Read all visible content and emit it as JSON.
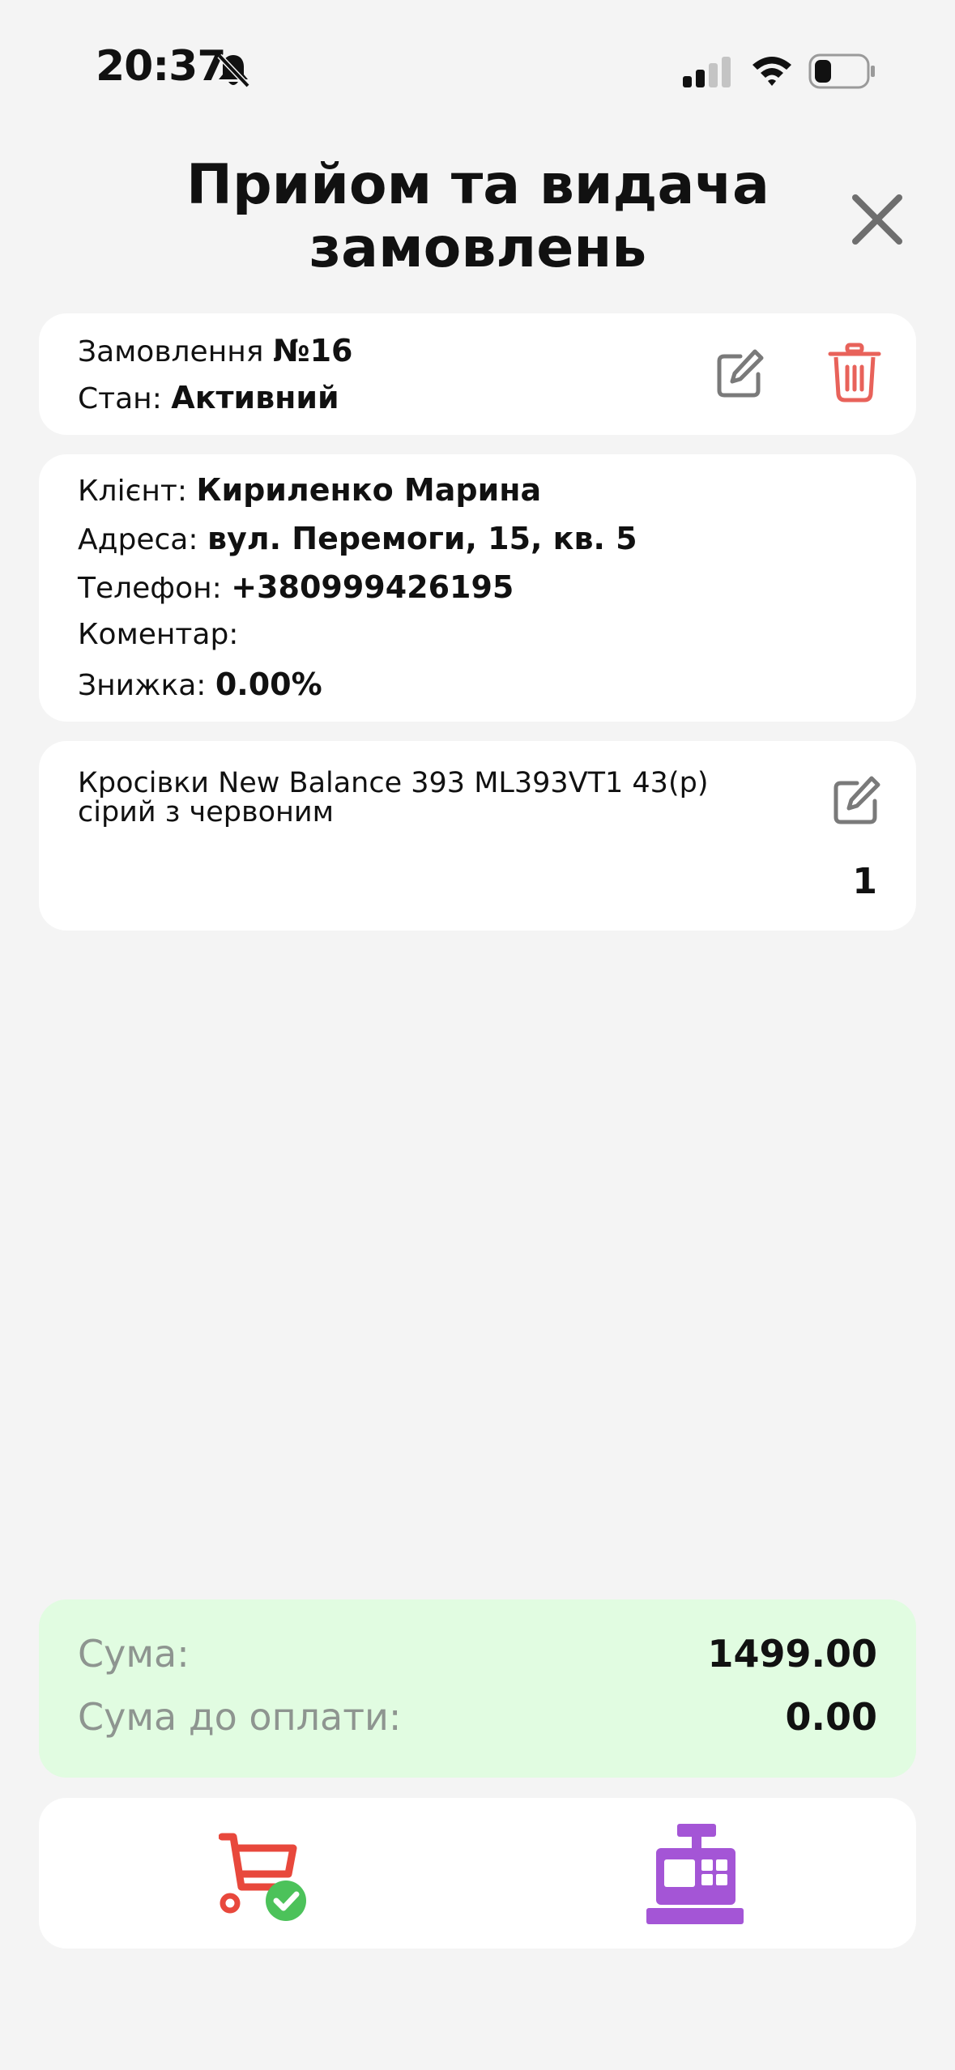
{
  "status_bar": {
    "time": "20:37"
  },
  "header": {
    "title": "Прийом та видача замовлень"
  },
  "order": {
    "order_label": "Замовлення ",
    "order_number": "№16",
    "state_label": "Стан: ",
    "state_value": "Активний"
  },
  "client": {
    "name_label": "Клієнт: ",
    "name_value": "Кириленко Марина",
    "address_label": "Адреса: ",
    "address_value": "вул. Перемоги, 15, кв. 5",
    "phone_label": "Телефон: ",
    "phone_value": "+380999426195",
    "comment_label": "Коментар:",
    "discount_label": "Знижка: ",
    "discount_value": "0.00%"
  },
  "items": [
    {
      "name": "Кросівки New Balance 393 ML393VT1 43(р) сірий з червоним",
      "quantity": "1"
    }
  ],
  "totals": {
    "sum_label": "Сума:",
    "sum_value": "1499.00",
    "due_label": "Сума до оплати:",
    "due_value": "0.00"
  },
  "colors": {
    "delete": "#e8625a",
    "cart": "#e8483c",
    "check": "#4cc25a",
    "register": "#a455d6",
    "totals_bg": "#e1fce1"
  },
  "icons": [
    "bell-slash-icon",
    "signal-icon",
    "wifi-icon",
    "battery-icon",
    "close-icon",
    "edit-icon",
    "trash-icon",
    "cart-check-icon",
    "cash-register-icon"
  ]
}
